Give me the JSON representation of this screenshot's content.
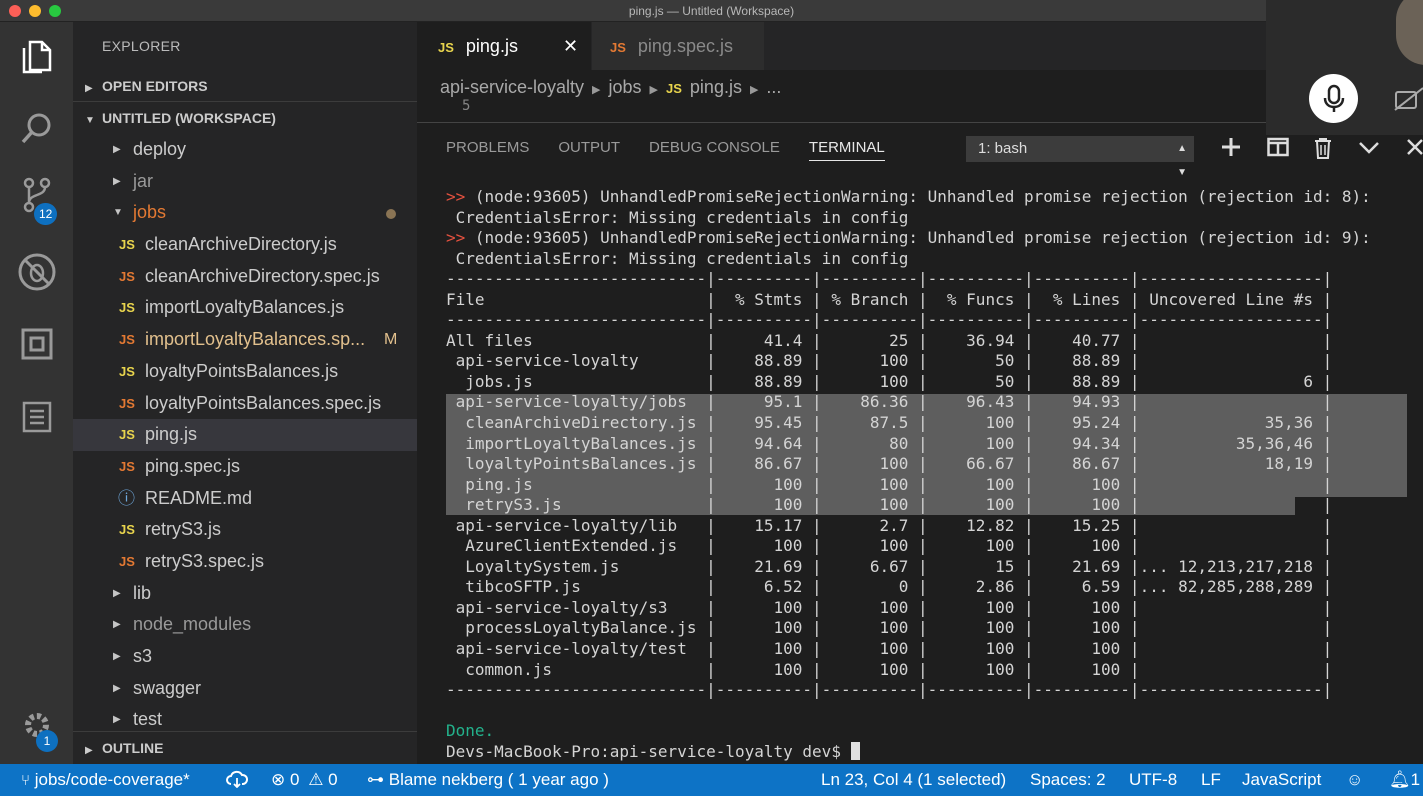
{
  "window": {
    "title": "ping.js — Untitled (Workspace)"
  },
  "activity": {
    "scm_badge": "12",
    "settings_badge": "1"
  },
  "sidebar": {
    "header": "EXPLORER",
    "open_editors": "OPEN EDITORS",
    "workspace": "UNTITLED (WORKSPACE)",
    "outline": "OUTLINE",
    "items": [
      {
        "label": "deploy",
        "type": "folder",
        "expanded": false
      },
      {
        "label": "jar",
        "type": "folder",
        "expanded": false
      },
      {
        "label": "jobs",
        "type": "folder",
        "expanded": true
      },
      {
        "label": "cleanArchiveDirectory.js",
        "type": "js"
      },
      {
        "label": "cleanArchiveDirectory.spec.js",
        "type": "spec"
      },
      {
        "label": "importLoyaltyBalances.js",
        "type": "js"
      },
      {
        "label": "importLoyaltyBalances.sp...",
        "type": "spec",
        "status": "M"
      },
      {
        "label": "loyaltyPointsBalances.js",
        "type": "js"
      },
      {
        "label": "loyaltyPointsBalances.spec.js",
        "type": "spec"
      },
      {
        "label": "ping.js",
        "type": "js",
        "selected": true
      },
      {
        "label": "ping.spec.js",
        "type": "spec"
      },
      {
        "label": "README.md",
        "type": "info"
      },
      {
        "label": "retryS3.js",
        "type": "js"
      },
      {
        "label": "retryS3.spec.js",
        "type": "spec"
      },
      {
        "label": "lib",
        "type": "folder"
      },
      {
        "label": "node_modules",
        "type": "folder"
      },
      {
        "label": "s3",
        "type": "folder"
      },
      {
        "label": "swagger",
        "type": "folder"
      },
      {
        "label": "test",
        "type": "folder"
      }
    ]
  },
  "tabs": [
    {
      "badge": "JS",
      "label": "ping.js",
      "active": true
    },
    {
      "badge": "JS",
      "label": "ping.spec.js",
      "active": false
    }
  ],
  "breadcrumb": {
    "root": "api-service-loyalty",
    "folder": "jobs",
    "badge": "JS",
    "file": "ping.js",
    "more": "...",
    "peek": "5"
  },
  "panel": {
    "tabs": [
      "PROBLEMS",
      "OUTPUT",
      "DEBUG CONSOLE",
      "TERMINAL"
    ],
    "active_tab": "TERMINAL",
    "terminal_select": "1: bash"
  },
  "terminal": {
    "lines": [
      {
        "prefix": ">> ",
        "text": "(node:93605) UnhandledPromiseRejectionWarning: Unhandled promise rejection (rejection id: 8):"
      },
      {
        "prefix": "",
        "text": " CredentialsError: Missing credentials in config"
      },
      {
        "prefix": ">> ",
        "text": "(node:93605) UnhandledPromiseRejectionWarning: Unhandled promise rejection (rejection id: 9):"
      },
      {
        "prefix": "",
        "text": " CredentialsError: Missing credentials in config"
      },
      {
        "prefix": "",
        "text": "---------------------------|----------|----------|----------|----------|-------------------|"
      },
      {
        "prefix": "",
        "text": "File                       |  % Stmts | % Branch |  % Funcs |  % Lines | Uncovered Line #s |"
      },
      {
        "prefix": "",
        "text": "---------------------------|----------|----------|----------|----------|-------------------|"
      },
      {
        "prefix": "",
        "text": "All files                  |     41.4 |       25 |    36.94 |    40.77 |                   |"
      },
      {
        "prefix": "",
        "text": " api-service-loyalty       |    88.89 |      100 |       50 |    88.89 |                   |"
      },
      {
        "prefix": "",
        "text": "  jobs.js                  |    88.89 |      100 |       50 |    88.89 |                 6 |"
      },
      {
        "prefix": "",
        "text": " api-service-loyalty/jobs  |     95.1 |    86.36 |    96.43 |    94.93 |                   |"
      },
      {
        "prefix": "",
        "text": "  cleanArchiveDirectory.js |    95.45 |     87.5 |      100 |    95.24 |             35,36 |"
      },
      {
        "prefix": "",
        "text": "  importLoyaltyBalances.js |    94.64 |       80 |      100 |    94.34 |          35,36,46 |"
      },
      {
        "prefix": "",
        "text": "  loyaltyPointsBalances.js |    86.67 |      100 |    66.67 |    86.67 |             18,19 |"
      },
      {
        "prefix": "",
        "text": "  ping.js                  |      100 |      100 |      100 |      100 |                   |"
      },
      {
        "prefix": "",
        "text": "  retryS3.js               |      100 |      100 |      100 |      100 |                   |"
      },
      {
        "prefix": "",
        "text": " api-service-loyalty/lib   |    15.17 |      2.7 |    12.82 |    15.25 |                   |"
      },
      {
        "prefix": "",
        "text": "  AzureClientExtended.js   |      100 |      100 |      100 |      100 |                   |"
      },
      {
        "prefix": "",
        "text": "  LoyaltySystem.js         |    21.69 |     6.67 |       15 |    21.69 |... 12,213,217,218 |"
      },
      {
        "prefix": "",
        "text": "  tibcoSFTP.js             |     6.52 |        0 |     2.86 |     6.59 |... 82,285,288,289 |"
      },
      {
        "prefix": "",
        "text": " api-service-loyalty/s3    |      100 |      100 |      100 |      100 |                   |"
      },
      {
        "prefix": "",
        "text": "  processLoyaltyBalance.js |      100 |      100 |      100 |      100 |                   |"
      },
      {
        "prefix": "",
        "text": " api-service-loyalty/test  |      100 |      100 |      100 |      100 |                   |"
      },
      {
        "prefix": "",
        "text": "  common.js                |      100 |      100 |      100 |      100 |                   |"
      },
      {
        "prefix": "",
        "text": "---------------------------|----------|----------|----------|----------|-------------------|"
      },
      {
        "prefix": "",
        "text": ""
      },
      {
        "prefix": "",
        "text": "Done.",
        "color": "green"
      },
      {
        "prefix": "",
        "text": "Devs-MacBook-Pro:api-service-loyalty dev$ ",
        "cursor": true
      }
    ]
  },
  "status": {
    "branch": "jobs/code-coverage*",
    "errors": "0",
    "warnings": "0",
    "blame": "Blame nekberg ( 1 year ago )",
    "position": "Ln 23, Col 4 (1 selected)",
    "spaces": "Spaces: 2",
    "encoding": "UTF-8",
    "eol": "LF",
    "language": "JavaScript",
    "notifications": "1"
  }
}
